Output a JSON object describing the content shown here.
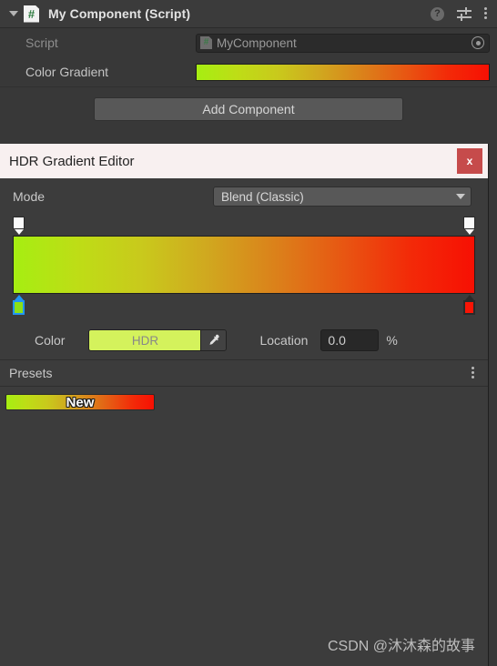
{
  "inspector": {
    "component_title": "My Component (Script)",
    "script_icon": "csharp-script-icon",
    "foldout_state": "expanded",
    "header_icons": [
      {
        "name": "help-icon",
        "glyph": "?"
      },
      {
        "name": "preset-icon",
        "glyph": "sliders"
      },
      {
        "name": "more-menu-icon",
        "glyph": "kebab"
      }
    ],
    "rows": [
      {
        "label": "Script",
        "value": "MyComponent",
        "type": "object-field",
        "disabled": true
      },
      {
        "label": "Color Gradient",
        "value": "",
        "type": "gradient-field",
        "disabled": false
      }
    ],
    "add_component_label": "Add Component"
  },
  "gradient_editor": {
    "title": "HDR Gradient Editor",
    "close_label": "x",
    "mode_label": "Mode",
    "mode_value": "Blend (Classic)",
    "color_label": "Color",
    "color_swatch_label": "HDR",
    "eyedropper_icon": "eyedropper-icon",
    "location_label": "Location",
    "location_value": "0.0",
    "location_unit": "%",
    "presets_label": "Presets",
    "presets_menu_icon": "kebab",
    "presets": [
      {
        "name": "New"
      }
    ],
    "gradient_css": "linear-gradient(to right, #A6EE12 0%, #BEDD16 14%, #C9C91C 28%, #D0A81F 42%, #DC7E1A 58%, #E85512 72%, #F32A08 86%, #F71003 100%)",
    "alpha_keys": [
      {
        "position_pct": 0,
        "alpha": 1
      },
      {
        "position_pct": 100,
        "alpha": 1
      }
    ],
    "color_keys": [
      {
        "position_pct": 0,
        "color": "#8CE016",
        "selected": true
      },
      {
        "position_pct": 100,
        "color": "#FA1405",
        "selected": false
      }
    ],
    "selected_color_hex": "#D4F25C"
  },
  "watermark": "CSDN @沐沐森的故事",
  "colors": {
    "panel_bg": "#3C3C3C",
    "inspector_bg": "#383838",
    "titlebar_bg": "#F8F0F0",
    "close_red": "#C64B4B",
    "selection_blue": "#2196F3"
  }
}
